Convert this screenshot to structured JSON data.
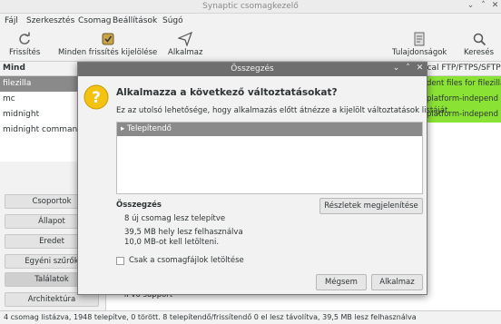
{
  "window": {
    "title": "Synaptic csomagkezelő"
  },
  "menu": [
    "Fájl",
    "Szerkesztés",
    "Csomag",
    "Beállítások",
    "Súgó"
  ],
  "toolbar": {
    "refresh": "Frissítés",
    "mark_all": "Minden frissítés kijelölése",
    "apply": "Alkalmaz",
    "properties": "Tulajdonságok",
    "search": "Keresés"
  },
  "package_list": {
    "column_header": "Mind",
    "description_fragment": "ical FTP/FTPS/SFTP",
    "rows": [
      {
        "name": "filezilla",
        "desc": "dent files for filezilla",
        "selected": true
      },
      {
        "name": "mc",
        "desc": "platform-independ",
        "selected": false
      },
      {
        "name": "midnight",
        "desc": "platform-independ",
        "selected": false
      },
      {
        "name": "midnight commande",
        "desc": "",
        "selected": false
      }
    ]
  },
  "filters": [
    "Csoportok",
    "Állapot",
    "Eredet",
    "Egyéni szűrők",
    "Találatok",
    "Architektúra"
  ],
  "description_text": "• IPv6 support",
  "statusbar": "4 csomag listázva, 1948 telepítve, 0 törött. 8 telepítendő/frissítendő 0 el lesz távolítva, 39,5 MB lesz felhasználva",
  "dialog": {
    "title": "Összegzés",
    "heading": "Alkalmazza a következő változtatásokat?",
    "intro": "Ez az utolsó lehetősége, hogy alkalmazás előtt átnézze a kijelölt változtatások listáját.",
    "tree_item": "Telepítendő",
    "summary_heading": "Összegzés",
    "summary_lines": [
      "8 új csomag lesz telepítve",
      "39,5 MB hely lesz felhasználva",
      "10,0 MB-ot kell letölteni."
    ],
    "details_button": "Részletek megjelenítése",
    "download_only_label": "Csak a csomagfájlok letöltése",
    "download_only_checked": false,
    "cancel_button": "Mégsem",
    "apply_button": "Alkalmaz"
  },
  "colors": {
    "highlight_green": "#8ae234",
    "selection_gray": "#8a8a8a",
    "accent_yellow": "#f5c211"
  }
}
